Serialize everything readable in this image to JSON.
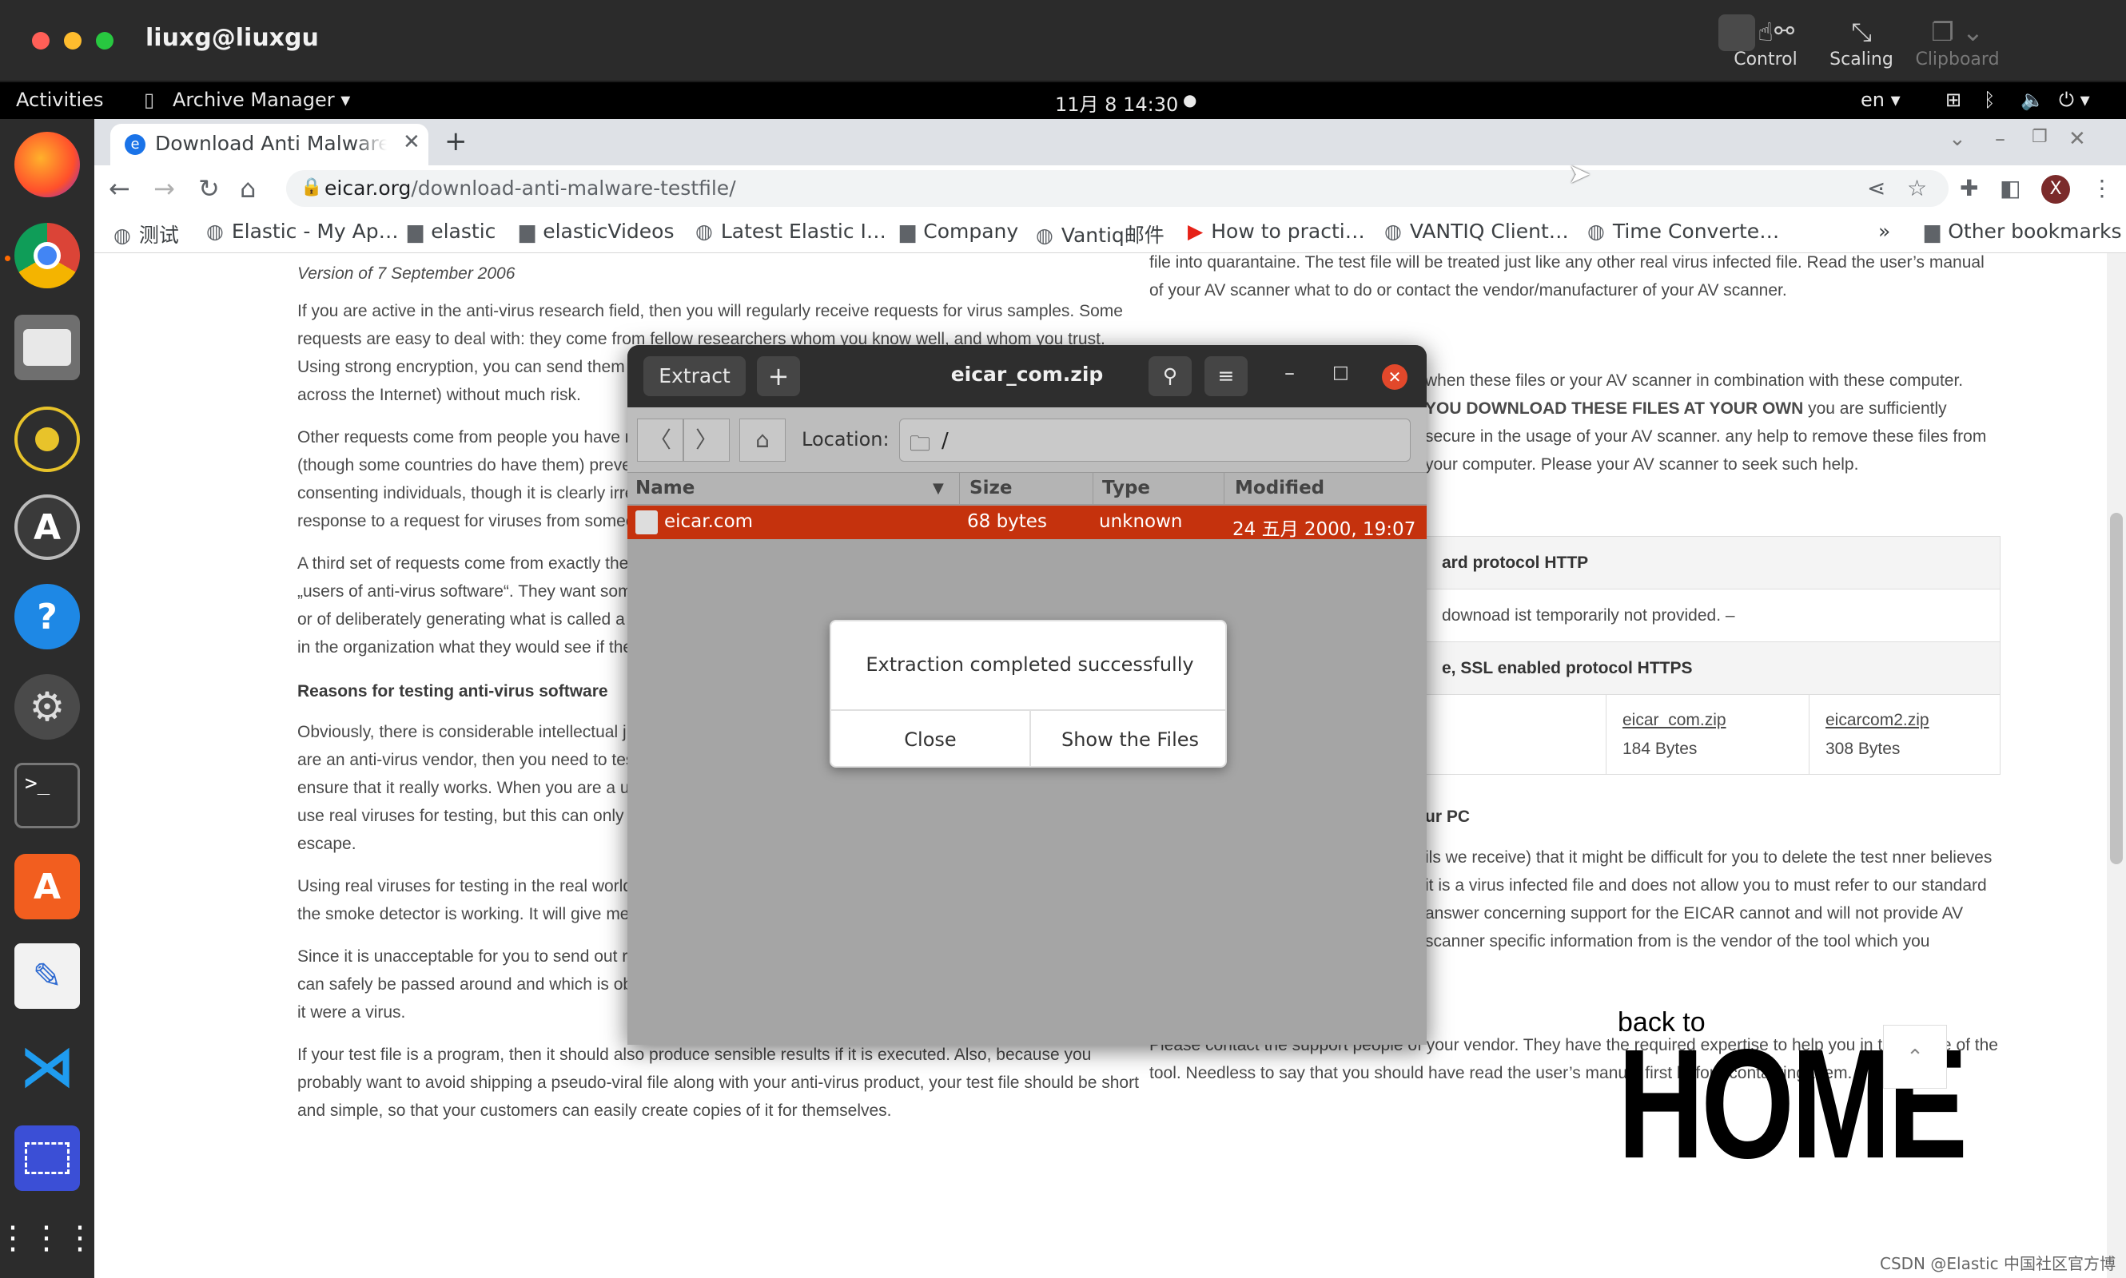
{
  "mac_window": {
    "title": "liuxg@liuxgu"
  },
  "vnc_toolbar": [
    {
      "label": "Control",
      "icon": "cursor-icon"
    },
    {
      "label": "Scaling",
      "icon": "scaling-icon"
    },
    {
      "label": "Clipboard",
      "icon": "clipboard-icon"
    }
  ],
  "gnome_topbar": {
    "activities": "Activities",
    "app_menu": "Archive Manager ▾",
    "clock": "11月 8  14:30",
    "lang": "en ▾"
  },
  "browser": {
    "tab_title": "Download Anti Malware Testfile",
    "url_domain": "eicar.org",
    "url_path": "/download-anti-malware-testfile/",
    "avatar_letter": "X",
    "bookmarks": [
      {
        "label": "测试",
        "icon": "globe-icon"
      },
      {
        "label": "Elastic - My Ap…",
        "icon": "globe-icon"
      },
      {
        "label": "elastic",
        "icon": "folder-icon"
      },
      {
        "label": "elasticVideos",
        "icon": "folder-icon"
      },
      {
        "label": "Latest Elastic I…",
        "icon": "globe-icon"
      },
      {
        "label": "Company",
        "icon": "folder-icon"
      },
      {
        "label": "Vantiq邮件",
        "icon": "globe-icon"
      },
      {
        "label": "How to practi…",
        "icon": "youtube-icon"
      },
      {
        "label": "VANTIQ Client…",
        "icon": "globe-icon"
      },
      {
        "label": "Time Converte…",
        "icon": "globe-icon"
      }
    ],
    "more_bookmarks": "»",
    "other_bookmarks": "Other bookmarks"
  },
  "page": {
    "left": {
      "version": "Version of 7 September 2006",
      "p1": "If you are active in the anti-virus research field, then you will regularly receive requests for virus samples. Some requests are easy to deal with: they come from fellow researchers whom you know well, and whom you trust. Using strong encryption, you can send them whatever they have asked for by almost any medium (including across the Internet) without much risk.",
      "p2": "Other requests come from people you have never heard of. There are no real laws against distributing viruses (though some countries do have them) preventing you from sending them the viruses, provided that they are consenting individuals, though it is clearly irresponsible to simply give viruses to anyone who asks. Your best response to a request for viruses from someone unknown to you is to decline politely.",
      "p3": "A third set of requests come from exactly the people you would expect to want to give virus samples to viruses „users of anti-virus software“. They want some way of checking that they have deployed their software correctly, or of deliberately generating what is called a „virus incident“ in order to test their procedures, or of showing others in the organization what they would see if they were hit by a real virus“.",
      "h1": "Reasons for testing anti-virus software",
      "p4": "Obviously, there is considerable intellectual justification for testing anti-virus software against real viruses. If you are an anti-virus vendor, then you need to test against all the viruses that exist to update your product, in order to ensure that it really works. When you are a user, you may wish to perform your tests in a „real“ environment. You use real viruses for testing, but this can only be done in a laboratory environment within which your viruses cannot escape.",
      "p5": "Using real viruses for testing in the real world is rather like setting fire to the dustbin in your office to see whether the smoke detector is working. It will give meaningful results, but with unappealing, unacceptable risks.",
      "p6": "Since it is unacceptable for you to send out real viruses for test or demonstration purposes, you need a file that can safely be passed around and which is obviously non-viral, but which your anti-virus software will react to as if it were a virus.",
      "p7": "If your test file is a program, then it should also produce sensible results if it is executed. Also, because you probably want to avoid shipping a pseudo-viral file along with your anti-virus product, your test file should be short and simple, so that your customers can easily create copies of it for themselves."
    },
    "right": {
      "p1": "file into quarantaine. The test file will be treated just like any other real virus infected file. Read the user’s manual of your AV scanner what to do or contact the vendor/manufacturer of your AV scanner.",
      "p2a": "when these files or your AV scanner in combination with these computer. ",
      "p2b": "YOU DOWNLOAD THESE FILES AT YOUR OWN",
      "p2c": " you are sufficiently secure in the usage of your AV scanner. any help to remove these files from your computer. Please your AV scanner to seek such help.",
      "table_h1": "ard protocol HTTP",
      "table_r1": "downoad ist temporarily not provided. –",
      "table_h2": "e, SSL enabled protocol HTTPS",
      "file1": "eicar_com.zip",
      "file1_size": "184 Bytes",
      "file2": "eicarcom2.zip",
      "file2_size": "308 Bytes",
      "h2": "ur PC",
      "p3": "ils we receive) that it might be difficult for you to delete the test nner believes it is a virus infected file and does not allow you to must refer to our standard answer concerning support for the EICAR cannot and will not provide AV scanner specific information from is the vendor of the tool which you",
      "p4": "Please contact the support people of your vendor. They have the required expertise to help you in the usage of the tool. Needless to say that you should have read the user’s manual first before contacting them."
    },
    "back_small": "back to",
    "back_big": "HOME",
    "watermark": "CSDN @Elastic 中国社区官方博客"
  },
  "archive_manager": {
    "extract_label": "Extract",
    "add_label": "+",
    "title": "eicar_com.zip",
    "location_label": "Location:",
    "location_value": "/",
    "columns": {
      "name": "Name",
      "size": "Size",
      "type": "Type",
      "modified": "Modified"
    },
    "file": {
      "name": "eicar.com",
      "size": "68 bytes",
      "type": "unknown",
      "modified": "24 五月 2000, 19:07"
    }
  },
  "dialog": {
    "message": "Extraction completed successfully",
    "close_label": "Close",
    "show_label": "Show the Files"
  },
  "colors": {
    "selection": "#c5320d",
    "mac_close": "#ff5f57"
  }
}
